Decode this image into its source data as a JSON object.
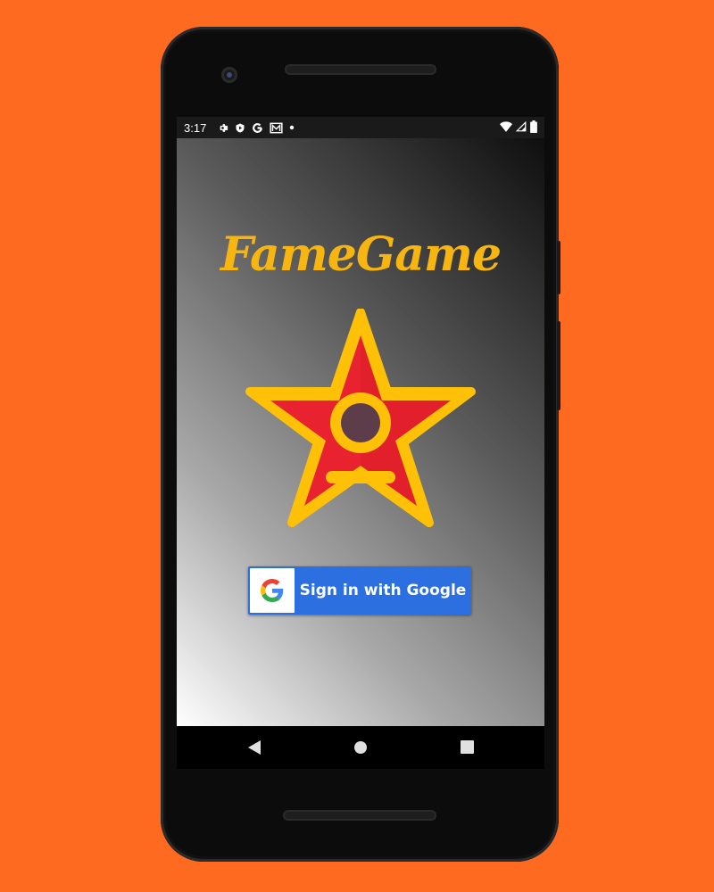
{
  "status_bar": {
    "time": "3:17",
    "left_icons": [
      "gear-icon",
      "shield-icon",
      "google-g-icon",
      "mail-icon",
      "dot-icon"
    ],
    "right_icons": [
      "wifi-icon",
      "signal-icon",
      "battery-icon"
    ]
  },
  "app": {
    "title": "FameGame",
    "sign_in_label": "Sign in with Google"
  },
  "nav_bar": {
    "icons": [
      "back-icon",
      "home-icon",
      "recents-icon"
    ]
  },
  "colors": {
    "background": "#ff6a21",
    "title": "#f7b511",
    "star_red": "#e8222e",
    "star_yellow": "#ffc107",
    "google_blue": "#2c6fe0"
  }
}
